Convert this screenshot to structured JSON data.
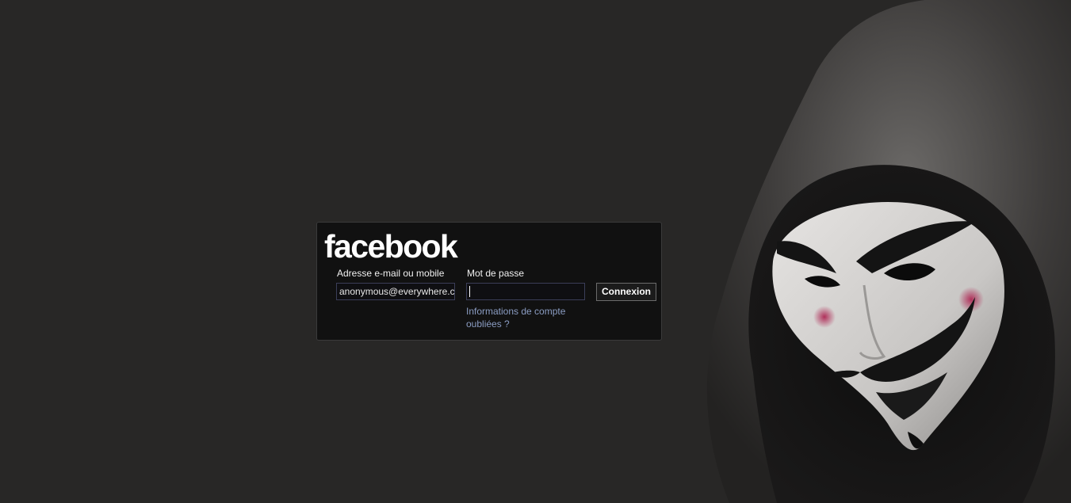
{
  "login": {
    "logo_text": "facebook",
    "email_label": "Adresse e-mail ou mobile",
    "email_value": "anonymous@everywhere.com",
    "password_label": "Mot de passe",
    "password_value": "",
    "login_button_label": "Connexion",
    "forgot_link": "Informations de compte oubliées ?"
  },
  "colors": {
    "background": "#282726",
    "panel": "#111111",
    "link": "#8b9dc3",
    "input_border": "#3b3e58"
  },
  "background_image": {
    "icon": "hooded-guy-fawkes-mask-figure"
  }
}
